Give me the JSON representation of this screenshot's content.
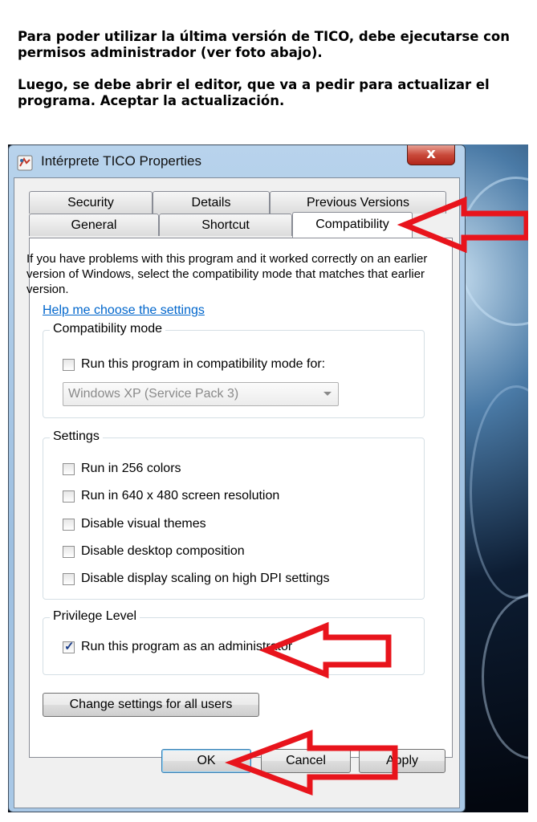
{
  "instructions": {
    "paragraph1": "Para poder utilizar la última versión de TICO, debe ejecutarse con permisos administrador (ver foto abajo).",
    "paragraph2": "Luego, se debe abrir el editor, que va a pedir para actualizar el programa. Aceptar la actualización."
  },
  "window": {
    "title": "Intérprete TICO Properties",
    "close_label": "x"
  },
  "tabs": [
    {
      "label": "Security"
    },
    {
      "label": "Details"
    },
    {
      "label": "Previous Versions"
    },
    {
      "label": "General"
    },
    {
      "label": "Shortcut"
    },
    {
      "label": "Compatibility"
    }
  ],
  "content": {
    "intro": "If you have problems with this program and it worked correctly on an earlier version of Windows, select the compatibility mode that matches that earlier version.",
    "help_link": "Help me choose the settings"
  },
  "compat_mode": {
    "title": "Compatibility mode",
    "checkbox_label": "Run this program in compatibility mode for:",
    "checked": false,
    "select_value": "Windows XP (Service Pack 3)"
  },
  "settings": {
    "title": "Settings",
    "items": [
      {
        "label": "Run in 256 colors",
        "checked": false
      },
      {
        "label": "Run in 640 x 480 screen resolution",
        "checked": false
      },
      {
        "label": "Disable visual themes",
        "checked": false
      },
      {
        "label": "Disable desktop composition",
        "checked": false
      },
      {
        "label": "Disable display scaling on high DPI settings",
        "checked": false
      }
    ]
  },
  "privilege": {
    "title": "Privilege Level",
    "checkbox_label": "Run this program as an administrator",
    "checked": true
  },
  "buttons": {
    "change_all_users": "Change settings for all users",
    "ok": "OK",
    "cancel": "Cancel",
    "apply": "Apply"
  },
  "colors": {
    "annotation_arrow": "#e8141c",
    "link": "#0066cc"
  }
}
